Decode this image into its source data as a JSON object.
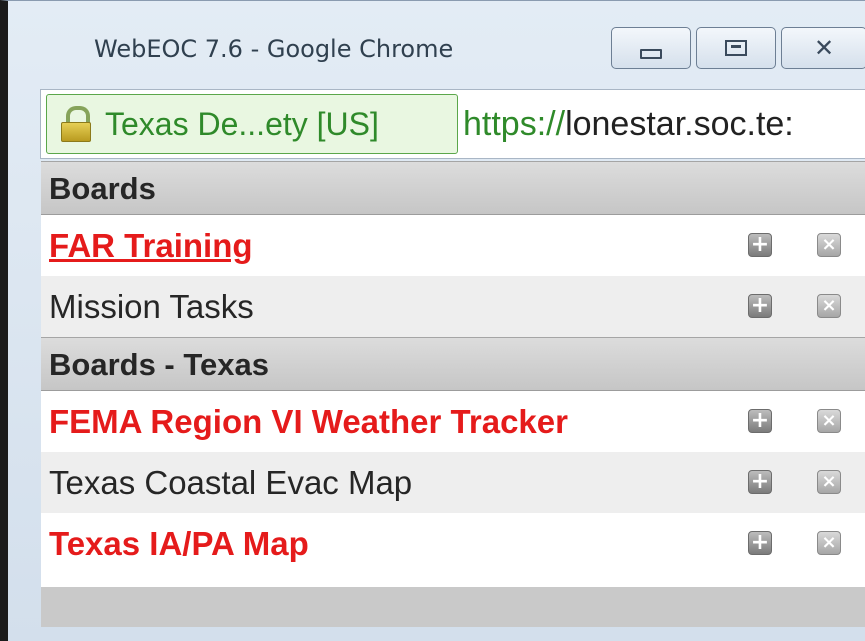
{
  "window": {
    "title": "WebEOC 7.6 - Google Chrome",
    "controls": {
      "minimize": "—",
      "maximize": "□",
      "close": "✕"
    }
  },
  "address_bar": {
    "certificate_label": "Texas De...ety [US]",
    "url_scheme": "https://",
    "url_rest": "lonestar.soc.te:"
  },
  "sections": [
    {
      "title": "Boards",
      "items": [
        {
          "label": "FAR Training",
          "style": "red-underline"
        },
        {
          "label": "Mission Tasks",
          "style": "normal"
        }
      ]
    },
    {
      "title": "Boards - Texas",
      "items": [
        {
          "label": "FEMA Region VI Weather Tracker",
          "style": "red"
        },
        {
          "label": "Texas Coastal Evac Map",
          "style": "normal"
        },
        {
          "label": "Texas IA/PA Map",
          "style": "red"
        }
      ]
    }
  ],
  "row_buttons": {
    "add": "+",
    "remove": "×"
  },
  "icons": [
    "lock-icon",
    "plus-icon",
    "close-icon",
    "minimize-icon",
    "maximize-icon"
  ],
  "colors": {
    "highlight_red": "#e51b1b",
    "secure_green": "#2f8a2a"
  }
}
